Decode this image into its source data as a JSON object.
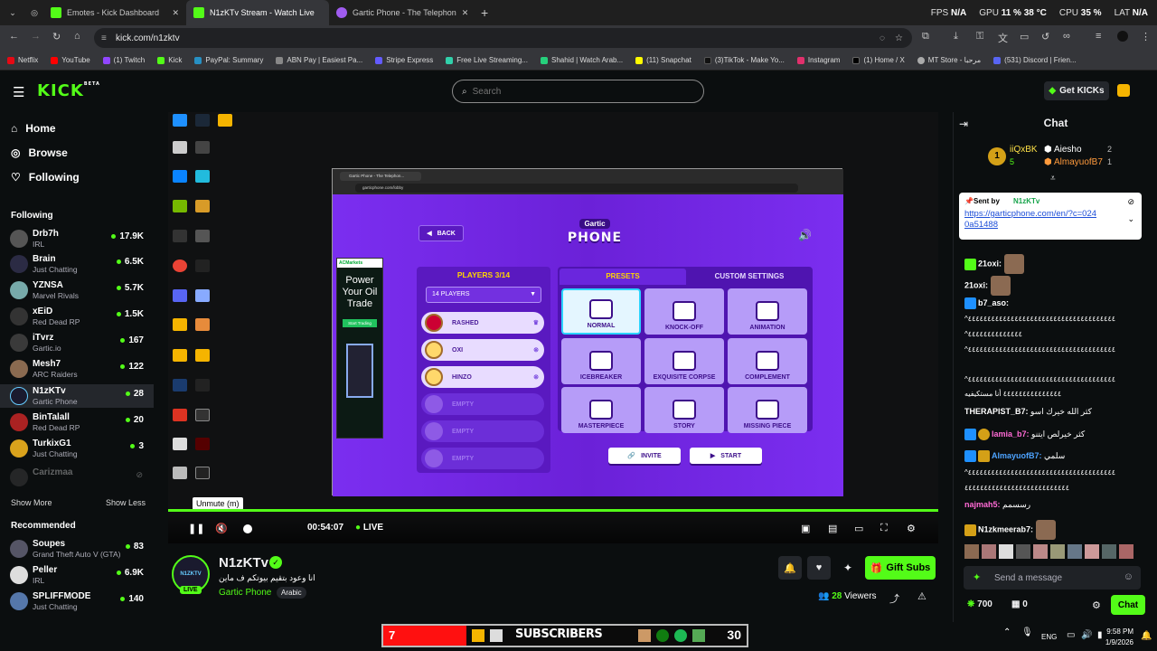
{
  "browser": {
    "tabs": [
      {
        "label": "Emotes - Kick Dashboard",
        "color": "#53fc18"
      },
      {
        "label": "N1zKTv Stream - Watch Live",
        "color": "#53fc18"
      },
      {
        "label": "Gartic Phone - The Telephon",
        "color": "#a05cf0"
      }
    ],
    "new_tab": "+",
    "stats": {
      "fps_label": "FPS",
      "fps": "N/A",
      "gpu_label": "GPU",
      "gpu": "11 % 38 °C",
      "cpu_label": "CPU",
      "cpu": "35 %",
      "lat_label": "LAT",
      "lat": "N/A"
    },
    "url": "kick.com/n1zktv",
    "bookmarks": [
      "Netflix",
      "YouTube",
      "(1) Twitch",
      "Kick",
      "PayPal: Summary",
      "ABN Pay | Easiest Pa...",
      "Stripe Express",
      "Free Live Streaming...",
      "Shahid | Watch Arab...",
      "(11) Snapchat",
      "(3)TikTok - Make Yo...",
      "Instagram",
      "(1) Home / X",
      "MT Store - مرحبا",
      "(531) Discord | Frien..."
    ]
  },
  "header": {
    "logo": "KICK",
    "logo_sup": "BETA",
    "search_placeholder": "Search",
    "get_kicks": "Get KICKs"
  },
  "sidebar": {
    "nav": [
      {
        "label": "Home",
        "icon": "home-icon"
      },
      {
        "label": "Browse",
        "icon": "compass-icon"
      },
      {
        "label": "Following",
        "icon": "heart-icon"
      }
    ],
    "following_title": "Following",
    "following": [
      {
        "name": "Drb7h",
        "category": "IRL",
        "viewers": "17.9K"
      },
      {
        "name": "Brain",
        "category": "Just Chatting",
        "viewers": "6.5K"
      },
      {
        "name": "YZNSA",
        "category": "Marvel Rivals",
        "viewers": "5.7K"
      },
      {
        "name": "xEiD",
        "category": "Red Dead RP",
        "viewers": "1.5K"
      },
      {
        "name": "iTvrz",
        "category": "Gartic.io",
        "viewers": "167"
      },
      {
        "name": "Mesh7",
        "category": "ARC Raiders",
        "viewers": "122"
      },
      {
        "name": "N1zKTv",
        "category": "Gartic Phone",
        "viewers": "28"
      },
      {
        "name": "BinTalall",
        "category": "Red Dead RP",
        "viewers": "20"
      },
      {
        "name": "TurkixG1",
        "category": "Just Chatting",
        "viewers": "3"
      }
    ],
    "offline_channel": "Carizmaa",
    "show_more": "Show More",
    "show_less": "Show Less",
    "recommended_title": "Recommended",
    "recommended": [
      {
        "name": "Soupes",
        "category": "Grand Theft Auto V (GTA)",
        "viewers": "83"
      },
      {
        "name": "Peller",
        "category": "IRL",
        "viewers": "6.9K"
      },
      {
        "name": "SPLIFFMODE",
        "category": "Just Chatting",
        "viewers": "140"
      }
    ]
  },
  "video": {
    "game": {
      "browser_tab": "Gartic Phone - The Telephon...",
      "url": "garticphone.com/lobby",
      "back": "BACK",
      "logo_top": "Gartic",
      "logo_bottom": "PHONE",
      "players_title": "PLAYERS 3/14",
      "players_select": "14 PLAYERS",
      "players": [
        "RASHED",
        "OXI",
        "HINZO",
        "EMPTY",
        "EMPTY",
        "EMPTY"
      ],
      "tab_presets": "PRESETS",
      "tab_custom": "CUSTOM SETTINGS",
      "presets": [
        "NORMAL",
        "KNOCK-OFF",
        "ANIMATION",
        "ICEBREAKER",
        "EXQUISITE CORPSE",
        "COMPLEMENT",
        "MASTERPIECE",
        "STORY",
        "MISSING PIECE"
      ],
      "invite": "INVITE",
      "start": "START",
      "ad": {
        "brand": "ACMarkets",
        "headline": "Power Your Oil Trade",
        "cta": "Start Trading"
      }
    },
    "tooltip": "Unmute (m)",
    "time": "00:54:07",
    "live": "LIVE"
  },
  "stream": {
    "streamer": "N1zKTv",
    "avatar_text": "N1ZKTV",
    "title": "انا وعود بتقيم بيوتكم ف ماين",
    "category": "Gartic Phone",
    "language": "Arabic",
    "live_badge": "LIVE",
    "viewers": "28",
    "viewers_label": "Viewers",
    "gift_subs": "Gift Subs"
  },
  "chat": {
    "title": "Chat",
    "leaderboard": [
      {
        "name": "iiQxBK",
        "count": "5"
      },
      {
        "name": "Aiesho",
        "count": "2"
      },
      {
        "name": "AlmayuofB7",
        "count": "1"
      }
    ],
    "pinned": {
      "sent_by": "Sent by",
      "author": "N1zKTv",
      "link": "https://garticphone.com/en/?c=0240a51488"
    },
    "messages": [
      {
        "user": "21oxi:",
        "text": "",
        "color": "#ffffff"
      },
      {
        "user": "21oxi:",
        "text": "",
        "color": "#ffffff"
      },
      {
        "user": "b7_aso:",
        "text": "",
        "color": "#ffffff"
      },
      {
        "user": "",
        "text": "^٤٤٤٤٤٤٤٤٤٤٤٤٤٤٤٤٤٤٤٤٤٤٤٤٤٤٤٤٤٤٤٤٤٤٤٤٤٤",
        "color": "#ffffff"
      },
      {
        "user": "",
        "text": "^٤٤٤٤٤٤٤٤٤٤٤٤٤٤",
        "color": "#ffffff"
      },
      {
        "user": "",
        "text": "^٤٤٤٤٤٤٤٤٤٤٤٤٤٤٤٤٤٤٤٤٤٤٤٤٤٤٤٤٤٤٤٤٤٤٤٤٤٤",
        "color": "#ffffff"
      },
      {
        "user": "",
        "text": "^٤٤٤٤٤٤٤٤٤٤٤٤٤٤٤٤٤٤٤٤٤٤٤٤٤٤٤٤٤٤٤٤٤٤٤٤٤٤",
        "color": "#ffffff"
      },
      {
        "user": "",
        "text": "٤٤٤٤٤٤٤٤٤٤٤٤٤٤٤ أنا مستكيفيه",
        "color": "#ffffff"
      },
      {
        "user": "THERAPIST_B7:",
        "text": "كثر الله خيرك اسو",
        "color": "#ffffff"
      },
      {
        "user": "lamia_b7:",
        "text": "كثر خيرلص ايتنو",
        "color": "#ff6ad5"
      },
      {
        "user": "AlmayuofB7:",
        "text": "سلمي",
        "color": "#4da3ff"
      },
      {
        "user": "",
        "text": "^٤٤٤٤٤٤٤٤٤٤٤٤٤٤٤٤٤٤٤٤٤٤٤٤٤٤٤٤٤٤٤٤٤٤٤٤٤٤",
        "color": "#ffffff"
      },
      {
        "user": "",
        "text": "٤٤٤٤٤٤٤٤٤٤٤٤٤٤٤٤٤٤٤٤٤٤٤٤٤٤٤",
        "color": "#ffffff"
      },
      {
        "user": "najmah5:",
        "text": "رسسمم",
        "color": "#ff6ad5"
      },
      {
        "user": "N1zkmeerab7:",
        "text": "",
        "color": "#ffffff"
      }
    ],
    "input_placeholder": "Send a message",
    "points": "700",
    "extra_count": "0",
    "send": "Chat"
  },
  "overlay": {
    "sub_count_left": "7",
    "sub_title": "SUBSCRIBERS",
    "sub_count_right": "30"
  },
  "taskbar": {
    "lang": "ENG",
    "time": "9:58 PM",
    "date": "1/9/2026"
  }
}
